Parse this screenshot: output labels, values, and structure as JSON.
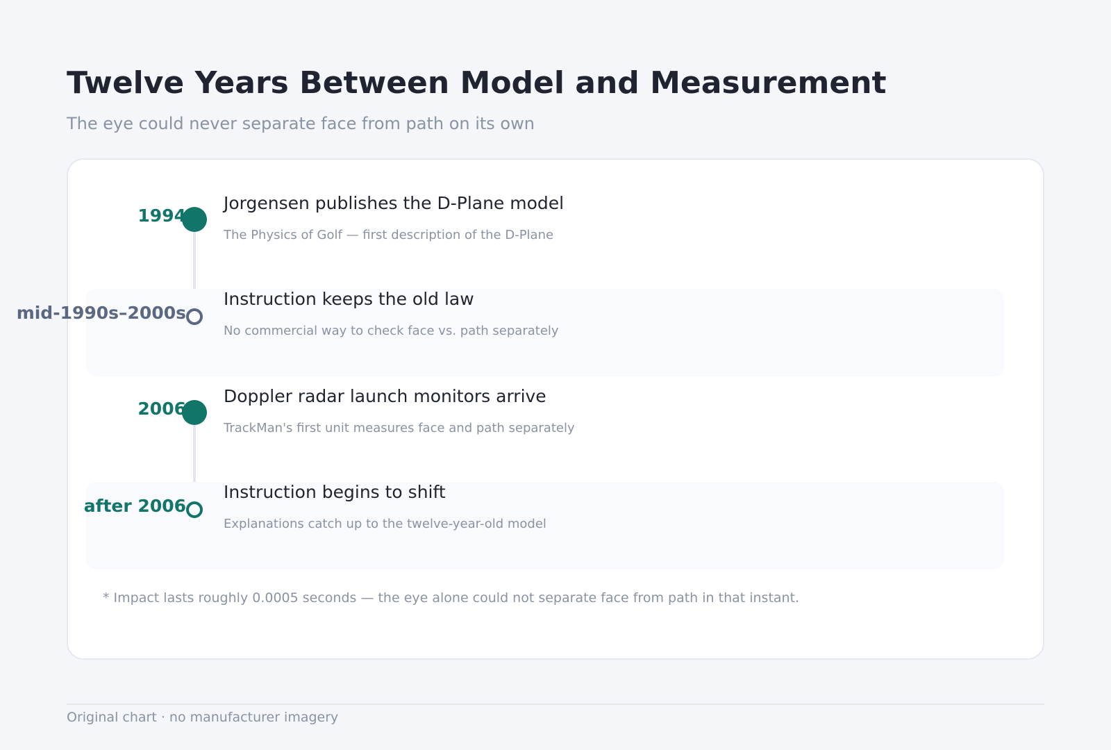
{
  "title": "Twelve Years Between Model and Measurement",
  "subtitle": "The eye could never separate face from path on its own",
  "events": [
    {
      "date": "1994",
      "title": "Jorgensen publishes the D-Plane model",
      "description": "The Physics of Golf — first description of the D-Plane",
      "marker": "filled",
      "color": "#12756a"
    },
    {
      "date": "mid-1990s–2000s",
      "title": "Instruction keeps the old law",
      "description": "No commercial way to check face vs. path separately",
      "marker": "hollow",
      "color": "#5a6882"
    },
    {
      "date": "2006",
      "title": "Doppler radar launch monitors arrive",
      "description": "TrackMan's first unit measures face and path separately",
      "marker": "filled",
      "color": "#12756a"
    },
    {
      "date": "after 2006",
      "title": "Instruction begins to shift",
      "description": "Explanations catch up to the twelve-year-old model",
      "marker": "hollow",
      "color": "#12756a"
    }
  ],
  "footnote": "* Impact lasts roughly 0.0005 seconds — the eye alone could not separate face from path in that instant.",
  "source": "Original chart · no manufacturer imagery"
}
